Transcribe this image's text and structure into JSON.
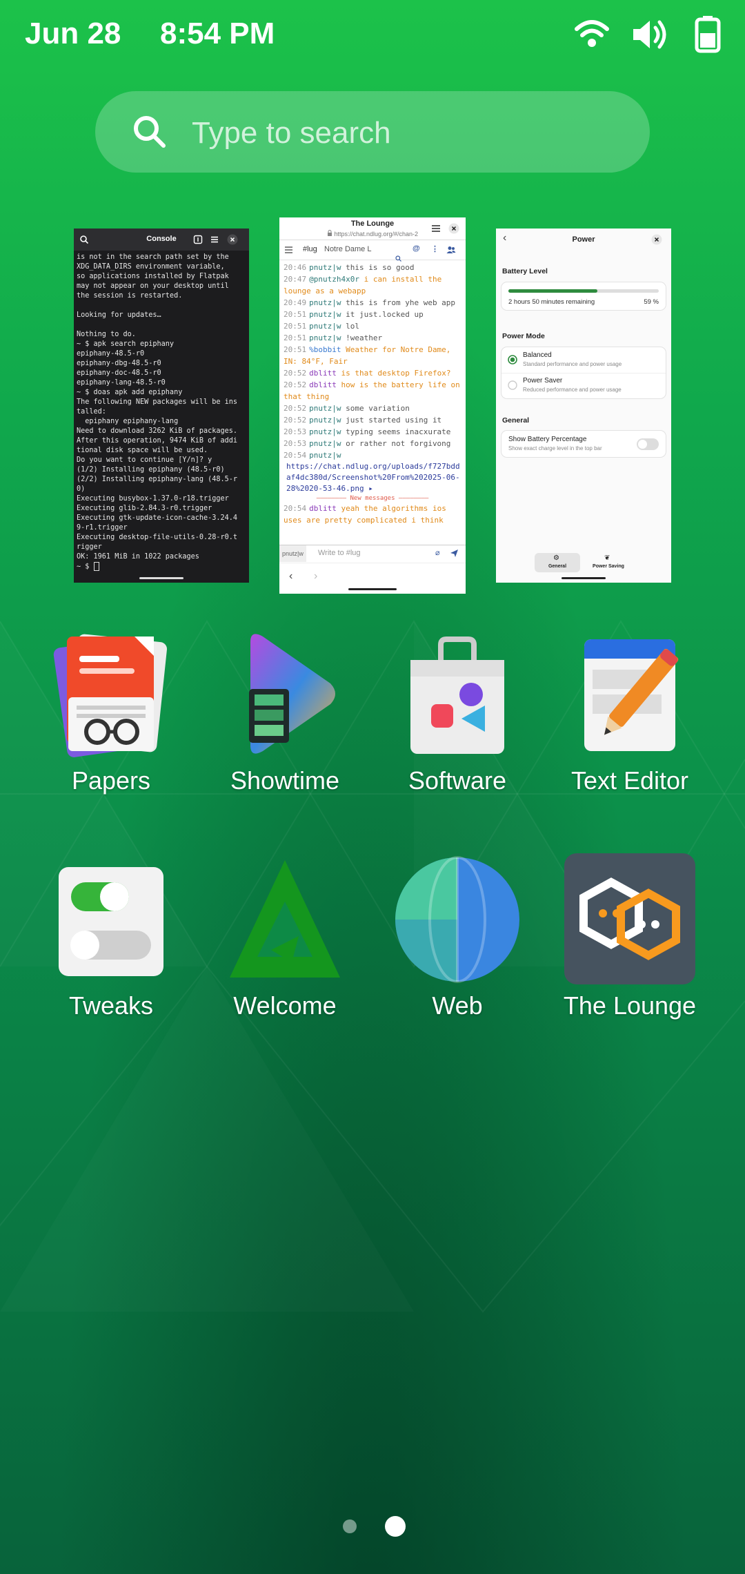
{
  "status_bar": {
    "date": "Jun 28",
    "time": "8:54 PM",
    "icons": [
      "wifi-icon",
      "volume-icon",
      "battery-icon"
    ]
  },
  "search": {
    "placeholder": "Type to search",
    "icon": "search-icon"
  },
  "windows": {
    "console": {
      "title": "Console",
      "lines": [
        "is not in the search path set by the",
        "XDG_DATA_DIRS environment variable,",
        "so applications installed by Flatpak",
        "may not appear on your desktop until",
        "the session is restarted.",
        "",
        "Looking for updates…",
        "",
        "Nothing to do.",
        "~ $ apk search epiphany",
        "epiphany-48.5-r0",
        "epiphany-dbg-48.5-r0",
        "epiphany-doc-48.5-r0",
        "epiphany-lang-48.5-r0",
        "~ $ doas apk add epiphany",
        "The following NEW packages will be ins",
        "talled:",
        "  epiphany epiphany-lang",
        "Need to download 3262 KiB of packages.",
        "After this operation, 9474 KiB of addi",
        "tional disk space will be used.",
        "Do you want to continue [Y/n]? y",
        "(1/2) Installing epiphany (48.5-r0)",
        "(2/2) Installing epiphany-lang (48.5-r",
        "0)",
        "Executing busybox-1.37.0-r18.trigger",
        "Executing glib-2.84.3-r0.trigger",
        "Executing gtk-update-icon-cache-3.24.4",
        "9-r1.trigger",
        "Executing desktop-file-utils-0.28-r0.t",
        "rigger",
        "OK: 1961 MiB in 1022 packages",
        "~ $ "
      ]
    },
    "lounge": {
      "title": "The Lounge",
      "url": "https://chat.ndlug.org/#/chan-2",
      "channel": "#lug",
      "topic": "Notre Dame L",
      "messages": [
        {
          "time": "20:46",
          "nick": "pnutz|w",
          "text": "this is so good",
          "nc": "g",
          "tc": "g"
        },
        {
          "time": "20:47",
          "nick": "@pnutzh4x0r",
          "text": "i can install the lounge as a webapp",
          "nc": "g",
          "tc": "o"
        },
        {
          "time": "20:49",
          "nick": "pnutz|w",
          "text": "this is from yhe web app",
          "nc": "g",
          "tc": "g"
        },
        {
          "time": "20:51",
          "nick": "pnutz|w",
          "text": "it just.locked up",
          "nc": "g",
          "tc": "g"
        },
        {
          "time": "20:51",
          "nick": "pnutz|w",
          "text": "lol",
          "nc": "g",
          "tc": "g"
        },
        {
          "time": "20:51",
          "nick": "pnutz|w",
          "text": "!weather",
          "nc": "g",
          "tc": "g"
        },
        {
          "time": "20:51",
          "nick": "%bobbit",
          "text": "Weather for Notre Dame, IN: 84°F, Fair",
          "nc": "b",
          "tc": "o"
        },
        {
          "time": "20:52",
          "nick": "dblitt",
          "text": "is that desktop Firefox?",
          "nc": "p",
          "tc": "o"
        },
        {
          "time": "20:52",
          "nick": "dblitt",
          "text": "how is the battery life on that thing",
          "nc": "p",
          "tc": "o"
        },
        {
          "time": "20:52",
          "nick": "pnutz|w",
          "text": "some variation",
          "nc": "g",
          "tc": "g"
        },
        {
          "time": "20:52",
          "nick": "pnutz|w",
          "text": "just started using it",
          "nc": "g",
          "tc": "g"
        },
        {
          "time": "20:53",
          "nick": "pnutz|w",
          "text": "typing seems inacxurate",
          "nc": "g",
          "tc": "g"
        },
        {
          "time": "20:53",
          "nick": "pnutz|w",
          "text": "or rather not forgivong",
          "nc": "g",
          "tc": "g"
        },
        {
          "time": "20:54",
          "nick": "pnutz|w",
          "text": "",
          "nc": "g",
          "tc": "g"
        }
      ],
      "link": "https://chat.ndlug.org/uploads/f727bddaf4dc380d/Screenshot%20From%202025-06-28%2020-53-46.png",
      "new_messages": "New messages",
      "last_message": {
        "time": "20:54",
        "nick": "dblitt",
        "text": "yeah the algorithms ios uses are pretty complicated i think"
      },
      "input_nick": "pnutz|w",
      "input_placeholder": "Write to #lug"
    },
    "power": {
      "title": "Power",
      "battery_level_label": "Battery Level",
      "remaining": "2 hours 50 minutes remaining",
      "percent": "59 %",
      "percent_value": 0.59,
      "power_mode_label": "Power Mode",
      "modes": [
        {
          "name": "Balanced",
          "desc": "Standard performance and power usage",
          "selected": true
        },
        {
          "name": "Power Saver",
          "desc": "Reduced performance and power usage",
          "selected": false
        }
      ],
      "general_label": "General",
      "show_pct_label": "Show Battery Percentage",
      "show_pct_desc": "Show exact charge level in the top bar",
      "show_pct_enabled": false,
      "tabs": [
        "General",
        "Power Saving"
      ]
    }
  },
  "apps": [
    {
      "name": "Papers",
      "icon": "papers-icon"
    },
    {
      "name": "Showtime",
      "icon": "showtime-icon"
    },
    {
      "name": "Software",
      "icon": "software-icon"
    },
    {
      "name": "Text Editor",
      "icon": "text-editor-icon"
    },
    {
      "name": "Tweaks",
      "icon": "tweaks-icon"
    },
    {
      "name": "Welcome",
      "icon": "welcome-icon"
    },
    {
      "name": "Web",
      "icon": "web-icon"
    },
    {
      "name": "The Lounge",
      "icon": "the-lounge-icon"
    }
  ],
  "pages": {
    "count": 2,
    "current": 2
  }
}
